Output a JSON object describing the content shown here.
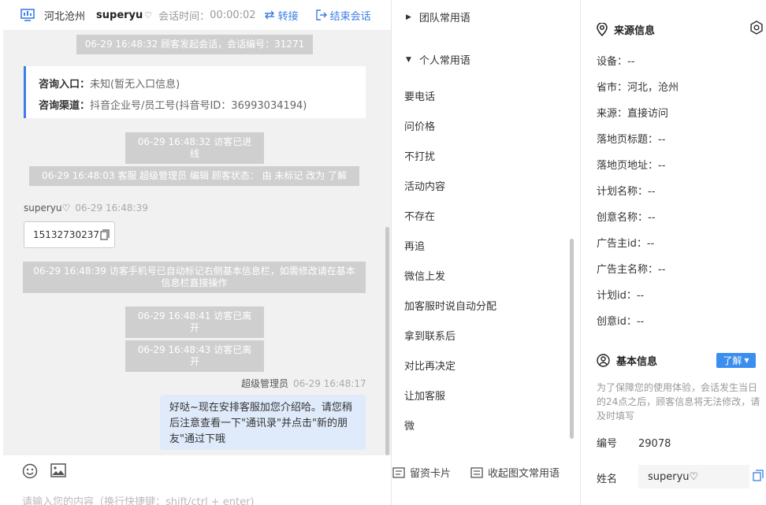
{
  "header": {
    "location": "河北沧州",
    "username": "superyu",
    "heart": "♡",
    "time_label": "会话时间：",
    "time_value": "00:00:02",
    "transfer": "转接",
    "end_session": "结束会话"
  },
  "messages": {
    "sys1": "06-29 16:48:32 顾客发起会话，会话编号：31271",
    "entry_label": "咨询入口：",
    "entry_value": "未知(暂无入口信息)",
    "channel_label": "咨询渠道：",
    "channel_value": "抖音企业号/员工号(抖音号ID：36993034194)",
    "sys2": "06-29 16:48:32 访客已进线",
    "sys3": "06-29 16:48:03 客服 超级管理员 编辑 顾客状态： 由 未标记 改为 了解",
    "visitor_name": "superyu♡",
    "visitor_time": "06-29 16:48:39",
    "phone": "15132730237",
    "sys4": "06-29 16:48:39 访客手机号已自动标记右侧基本信息栏，如需修改请在基本信息栏直接操作",
    "sys5": "06-29 16:48:41 访客已离开",
    "sys6": "06-29 16:48:43 访客已离开",
    "agent_name": "超级管理员",
    "agent_time": "06-29 16:48:17",
    "agent_text": "好哒~现在安排客服加您介绍哈。请您稍后注意查看一下\"通讯录\"并点击\"新的朋友\"通过下哦"
  },
  "input": {
    "placeholder": "请输入您的内容（换行快捷键：shift/ctrl + enter)"
  },
  "phrases": {
    "team_group": "团队常用语",
    "personal_group": "个人常用语",
    "items": [
      "要电话",
      "问价格",
      "不打扰",
      "活动内容",
      "不存在",
      "再追",
      "微信上发",
      "加客服时说自动分配",
      "拿到联系后",
      "对比再决定",
      "让加客服",
      "微"
    ],
    "card_button": "留资卡片",
    "collapse_button": "收起图文常用语"
  },
  "source": {
    "title": "来源信息",
    "rows": [
      "设备：--",
      "省市：河北，沧州",
      "来源：直接访问",
      "落地页标题：--",
      "落地页地址：--",
      "计划名称：--",
      "创意名称：--",
      "广告主id：--",
      "广告主名称：--",
      "计划id：--",
      "创意id：--"
    ]
  },
  "basic": {
    "title": "基本信息",
    "status": "了解",
    "note": "为了保障您的使用体验，会话发生当日的24点之后，顾客信息将无法修改，请及时填写",
    "id_label": "编号",
    "id_value": "29078",
    "name_label": "姓名",
    "name_value": "superyu♡"
  },
  "colors": {
    "accent": "#3a7ee6",
    "pill": "#3a8ef0",
    "system_msg": "#cfcfcf",
    "bubble": "#dfeafb"
  }
}
